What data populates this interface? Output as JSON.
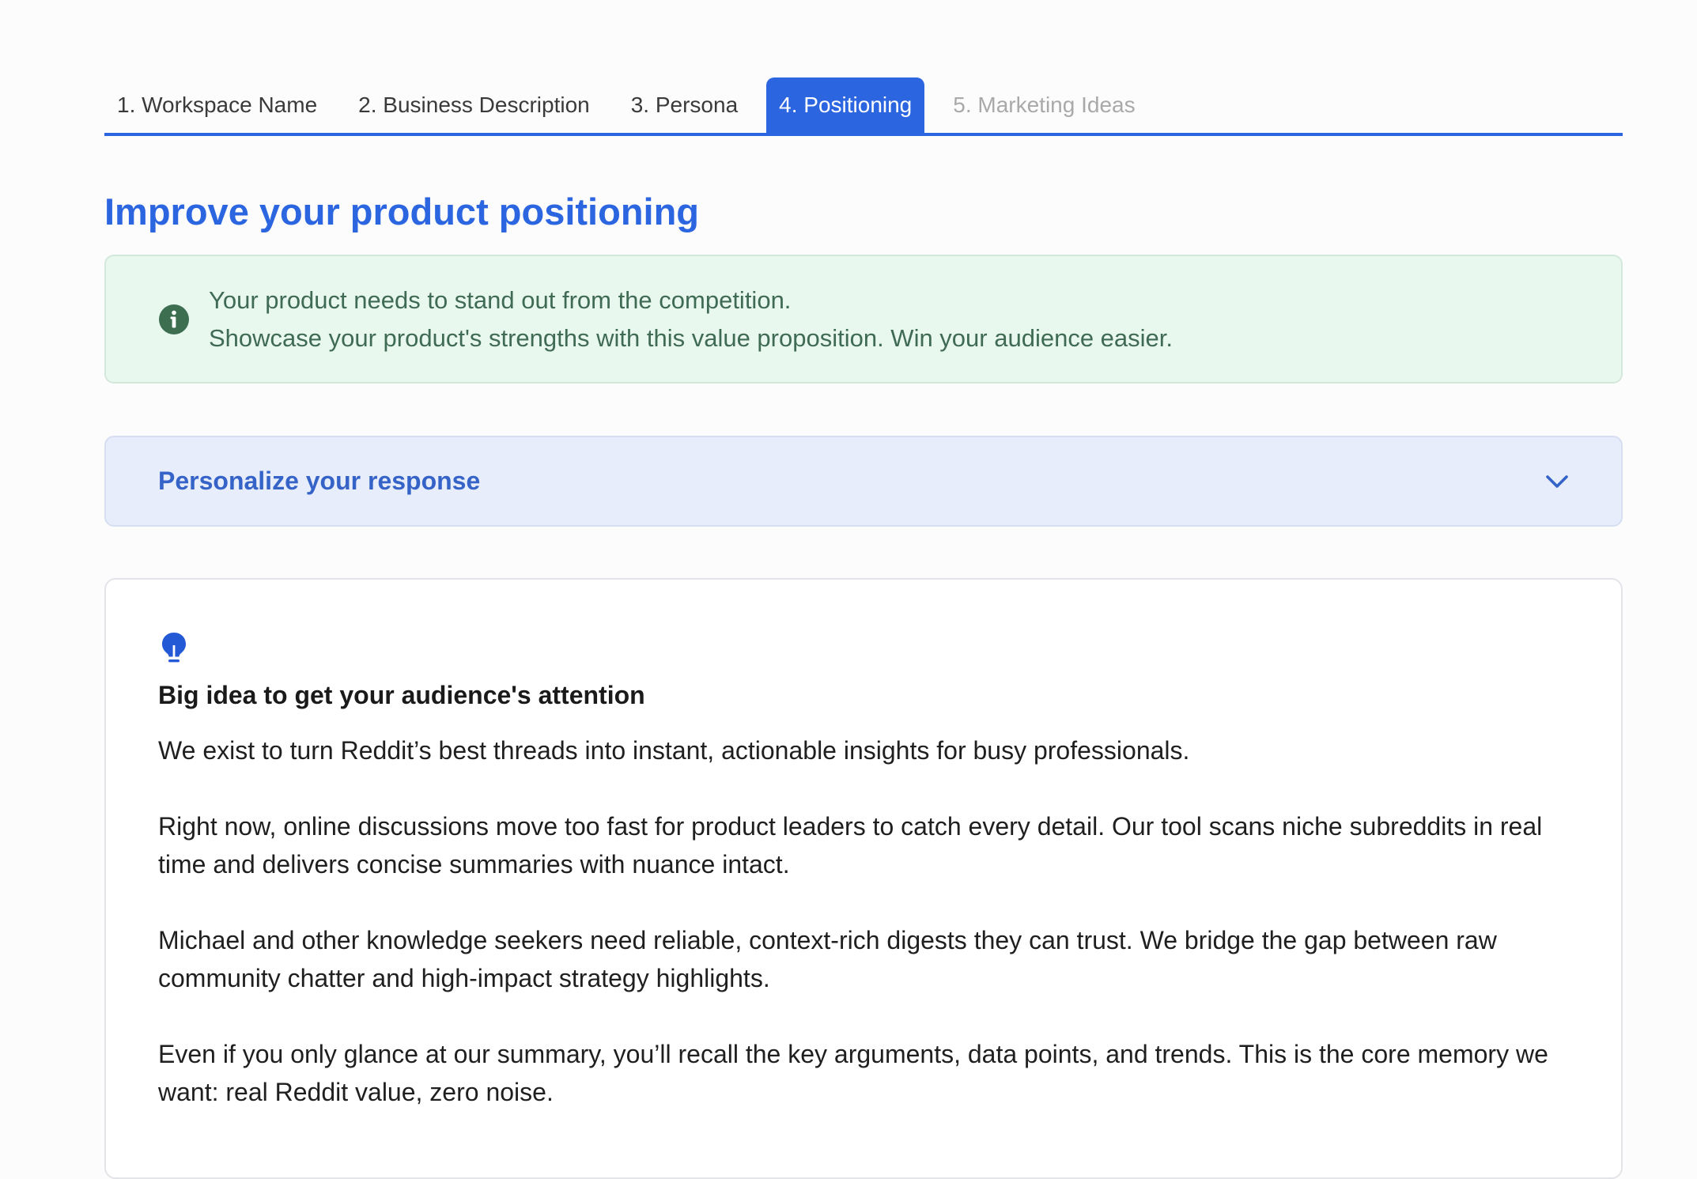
{
  "tabs": [
    {
      "label": "1. Workspace Name",
      "state": "default"
    },
    {
      "label": "2. Business Description",
      "state": "default"
    },
    {
      "label": "3. Persona",
      "state": "default"
    },
    {
      "label": "4. Positioning",
      "state": "active"
    },
    {
      "label": "5. Marketing Ideas",
      "state": "disabled"
    }
  ],
  "heading": "Improve your product positioning",
  "info": {
    "icon": "info-icon",
    "line1": "Your product needs to stand out from the competition.",
    "line2": "Showcase your product's strengths with this value proposition. Win your audience easier."
  },
  "accordion": {
    "title": "Personalize your response",
    "icon": "chevron-down-icon"
  },
  "card": {
    "icon": "lightbulb-icon",
    "title": "Big idea to get your audience's attention",
    "paragraphs": [
      "We exist to turn Reddit’s best threads into instant, actionable insights for busy professionals.",
      "Right now, online discussions move too fast for product leaders to catch every detail. Our tool scans niche subreddits in real time and delivers concise summaries with nuance intact.",
      "Michael and other knowledge seekers need reliable, context-rich digests they can trust. We bridge the gap between raw community chatter and high-impact strategy highlights.",
      "Even if you only glance at our summary, you’ll recall the key arguments, data points, and trends. This is the core memory we want: real Reddit value, zero noise."
    ]
  },
  "colors": {
    "accent": "#2b65e0",
    "info_bg": "#e9f8ee",
    "info_text": "#3f6a53",
    "accordion_bg": "#e7edfa"
  }
}
